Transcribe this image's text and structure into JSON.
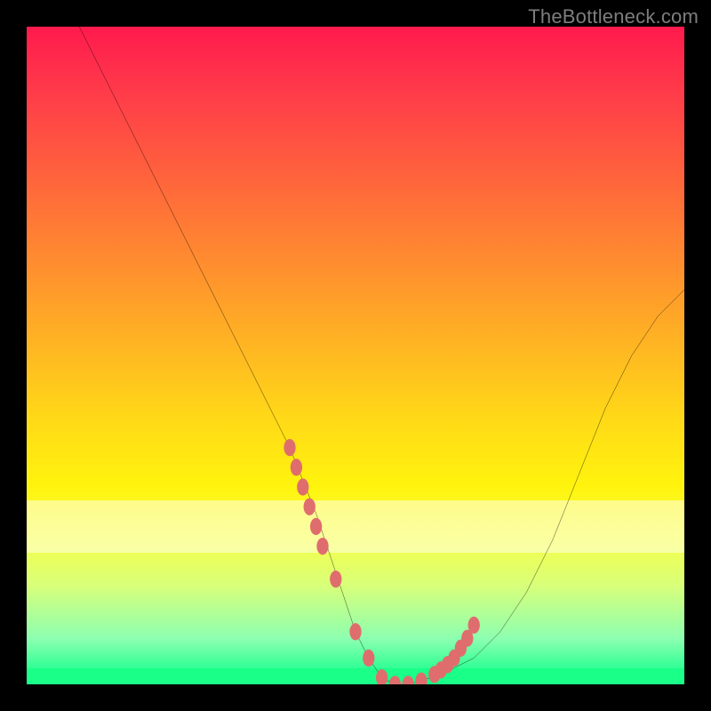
{
  "watermark": "TheBottleneck.com",
  "colors": {
    "frame": "#000000",
    "gradient_top": "#ff1a4d",
    "gradient_bottom": "#00ff88",
    "curve": "#000000",
    "dots": "#e06d6d",
    "watermark_text": "#7d7d7d"
  },
  "chart_data": {
    "type": "line",
    "title": "",
    "xlabel": "",
    "ylabel": "",
    "xlim": [
      0,
      100
    ],
    "ylim": [
      0,
      100
    ],
    "series": [
      {
        "name": "bottleneck-curve",
        "x": [
          8,
          12,
          16,
          20,
          24,
          28,
          32,
          36,
          40,
          42,
          44,
          46,
          48,
          50,
          52,
          54,
          56,
          58,
          60,
          64,
          68,
          72,
          76,
          80,
          84,
          88,
          92,
          96,
          100
        ],
        "y": [
          100,
          92,
          84,
          76,
          68,
          60,
          52,
          44,
          36,
          31,
          26,
          20,
          14,
          8,
          4,
          1,
          0,
          0,
          0.5,
          2,
          4,
          8,
          14,
          22,
          32,
          42,
          50,
          56,
          60
        ]
      }
    ],
    "highlight_dots": {
      "name": "selected-range",
      "x": [
        40,
        41,
        42,
        43,
        44,
        45,
        47,
        50,
        52,
        54,
        56,
        58,
        60,
        62,
        63,
        64,
        65,
        66,
        67,
        68
      ],
      "y": [
        36,
        33,
        30,
        27,
        24,
        21,
        16,
        8,
        4,
        1,
        0,
        0,
        0.5,
        1.5,
        2.2,
        3,
        4,
        5.5,
        7,
        9
      ]
    }
  }
}
